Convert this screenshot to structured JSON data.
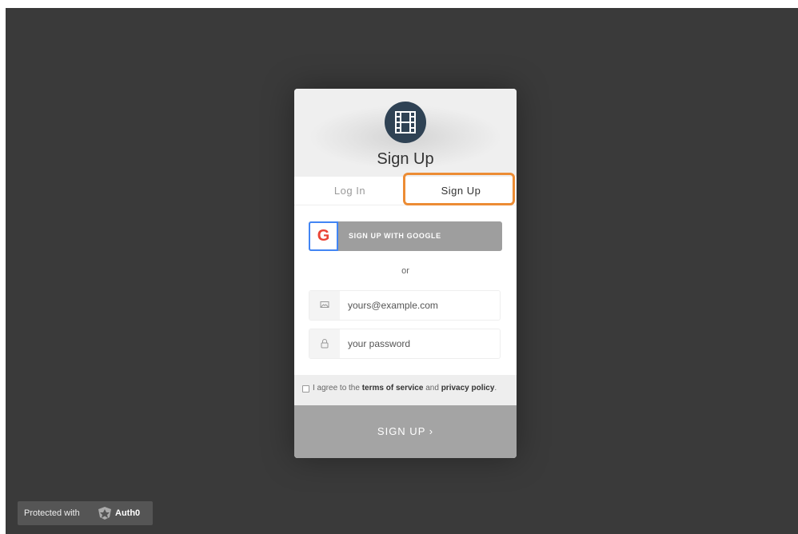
{
  "widget": {
    "title": "Sign Up",
    "logo_icon": "film-icon",
    "logo_color": "#2f4254",
    "tabs": [
      {
        "label": "Log In",
        "active": false
      },
      {
        "label": "Sign Up",
        "active": true
      }
    ],
    "google_button_label": "SIGN UP WITH GOOGLE",
    "google_icon_label": "G",
    "or_label": "or",
    "email_placeholder": "yours@example.com",
    "email_icon": "envelope-icon",
    "password_placeholder": "your password",
    "password_icon": "lock-icon",
    "terms": {
      "prefix": "I agree to the ",
      "terms_link": "terms of service",
      "middle": " and ",
      "privacy_link": "privacy policy",
      "suffix": ".",
      "checked": false
    },
    "submit_label": "SIGN UP ›",
    "highlight_color": "#ec8c34"
  },
  "footer_badge": {
    "text": "Protected with",
    "brand": "Auth0",
    "icon": "auth0-shield-icon"
  }
}
